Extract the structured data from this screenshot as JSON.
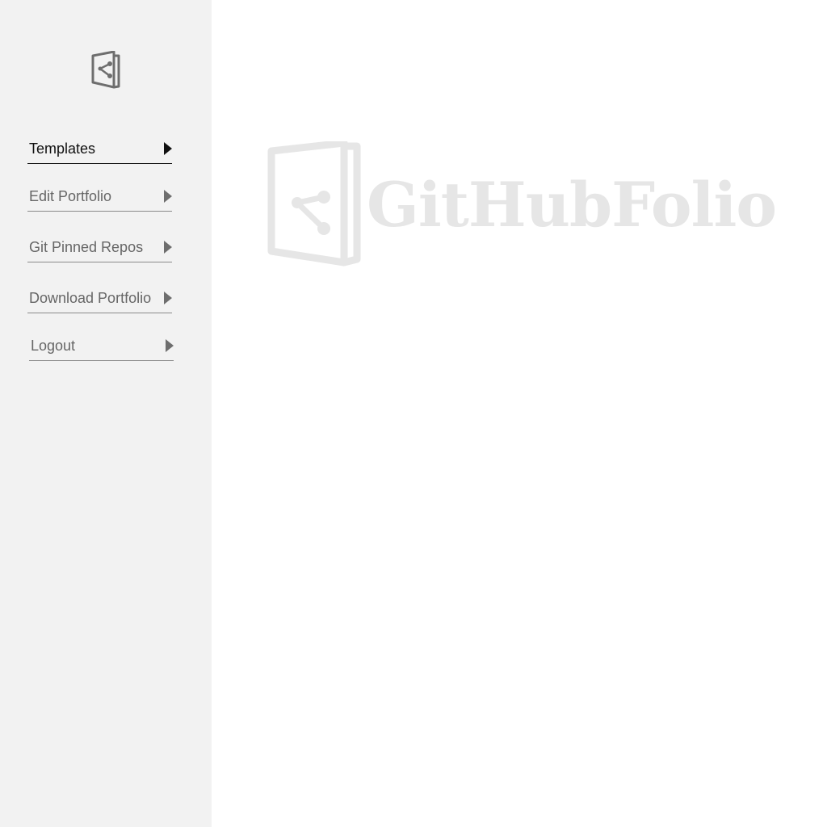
{
  "app": {
    "logo_text": "GitHubFolio"
  },
  "sidebar": {
    "logo_icon": "folio-door-icon",
    "items": [
      {
        "label": "Templates",
        "icon": "triangle-right-icon",
        "active": true
      },
      {
        "label": "Edit Portfolio",
        "icon": "triangle-right-icon",
        "active": false
      },
      {
        "label": "Git Pinned Repos",
        "icon": "triangle-right-icon",
        "active": false
      },
      {
        "label": "Download Portfolio",
        "icon": "triangle-right-icon",
        "active": false
      },
      {
        "label": "Logout",
        "icon": "triangle-right-icon",
        "active": false
      }
    ]
  },
  "colors": {
    "sidebar_bg": "#f2f2f2",
    "active_text": "#111111",
    "inactive_text": "#666666",
    "watermark": "#e6e6e6"
  }
}
